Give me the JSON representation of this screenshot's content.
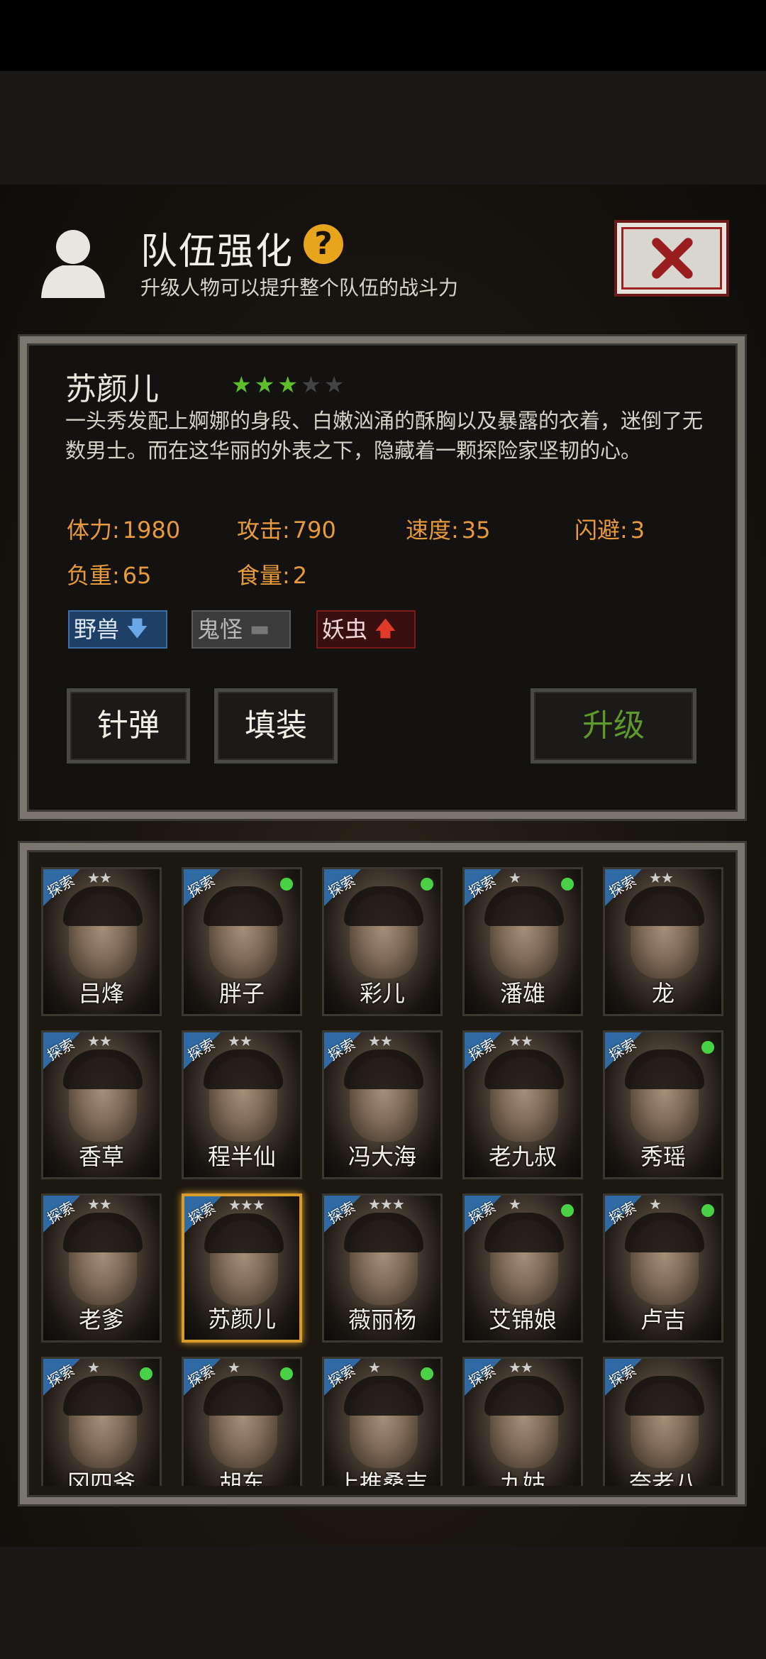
{
  "header": {
    "title": "队伍强化",
    "help_icon": "?",
    "subtitle": "升级人物可以提升整个队伍的战斗力"
  },
  "character": {
    "name": "苏颜儿",
    "stars_filled": 3,
    "stars_total": 5,
    "description": "一头秀发配上婀娜的身段、白嫩汹涌的酥胸以及暴露的衣着，迷倒了无数男士。而在这华丽的外表之下，隐藏着一颗探险家坚韧的心。",
    "stats": [
      {
        "label": "体力:",
        "value": "1980"
      },
      {
        "label": "攻击:",
        "value": "790"
      },
      {
        "label": "速度:",
        "value": "35"
      },
      {
        "label": "闪避:",
        "value": "3"
      },
      {
        "label": "负重:",
        "value": "65"
      },
      {
        "label": "食量:",
        "value": "2"
      }
    ],
    "tags": [
      {
        "label": "野兽",
        "trend": "down",
        "color": "#2c5a8c"
      },
      {
        "label": "鬼怪",
        "trend": "neutral",
        "color": "#555555"
      },
      {
        "label": "妖虫",
        "trend": "up",
        "color": "#8a1a1a"
      }
    ]
  },
  "buttons": {
    "needle": "针弹",
    "reload": "填装",
    "upgrade": "升级"
  },
  "cards_corner_label": "探索",
  "cards": [
    {
      "name": "吕烽",
      "stars": 2,
      "dot": false
    },
    {
      "name": "胖子",
      "stars": 0,
      "dot": true
    },
    {
      "name": "彩儿",
      "stars": 0,
      "dot": true
    },
    {
      "name": "潘雄",
      "stars": 1,
      "dot": true
    },
    {
      "name": "龙",
      "stars": 2,
      "dot": false
    },
    {
      "name": "香草",
      "stars": 2,
      "dot": false
    },
    {
      "name": "程半仙",
      "stars": 2,
      "dot": false
    },
    {
      "name": "冯大海",
      "stars": 2,
      "dot": false
    },
    {
      "name": "老九叔",
      "stars": 2,
      "dot": false
    },
    {
      "name": "秀瑶",
      "stars": 0,
      "dot": true
    },
    {
      "name": "老爹",
      "stars": 2,
      "dot": false
    },
    {
      "name": "苏颜儿",
      "stars": 3,
      "dot": false,
      "selected": true
    },
    {
      "name": "薇丽杨",
      "stars": 3,
      "dot": false
    },
    {
      "name": "艾锦娘",
      "stars": 1,
      "dot": true
    },
    {
      "name": "卢吉",
      "stars": 1,
      "dot": true
    },
    {
      "name": "冈四爷",
      "stars": 1,
      "dot": true
    },
    {
      "name": "胡东",
      "stars": 1,
      "dot": true
    },
    {
      "name": "上推桑吉",
      "stars": 1,
      "dot": true
    },
    {
      "name": "九姑",
      "stars": 2,
      "dot": false
    },
    {
      "name": "奈老八",
      "stars": 0,
      "dot": false
    }
  ]
}
